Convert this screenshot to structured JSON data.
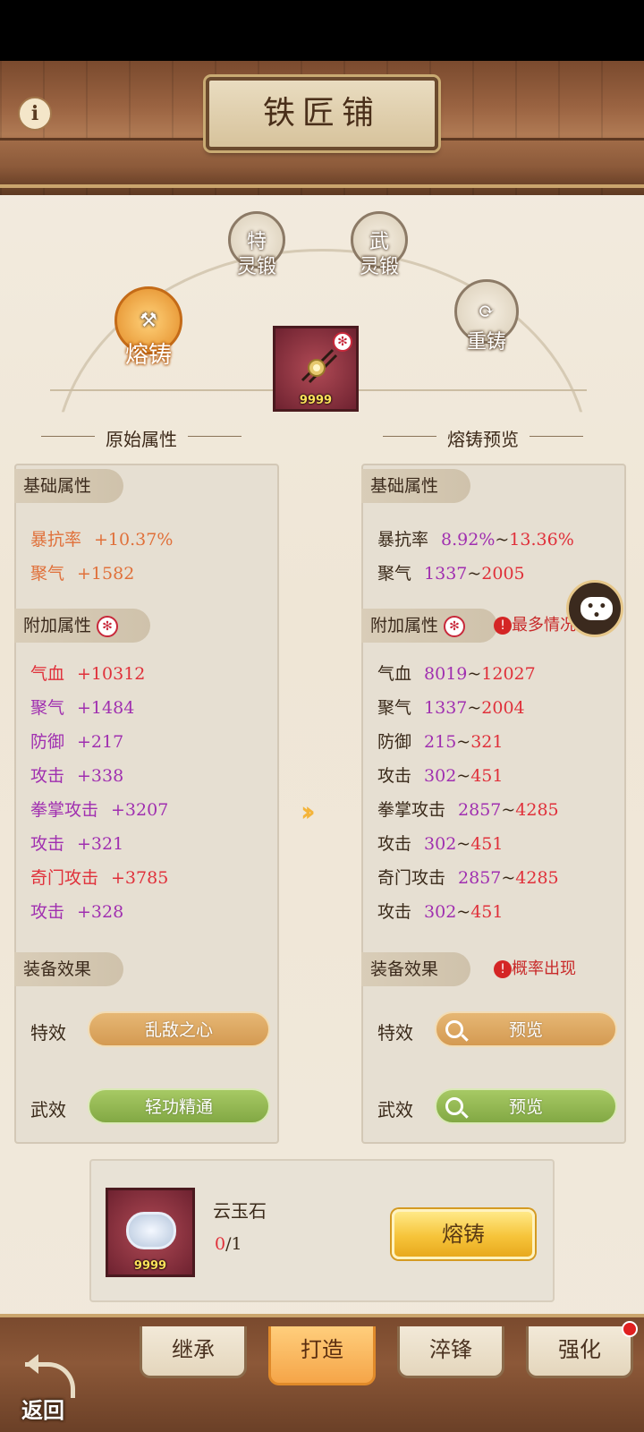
{
  "header": {
    "title": "铁匠铺",
    "info_icon": "i"
  },
  "modes": {
    "active": {
      "label": "熔铸",
      "icon": "anvil-icon"
    },
    "special": {
      "glyph": "特",
      "label": "灵锻"
    },
    "martial": {
      "glyph": "武",
      "label": "灵锻"
    },
    "recast": {
      "label": "重铸",
      "icon": "recycle-icon"
    }
  },
  "item": {
    "count": "9999",
    "icon": "hairpin-icon"
  },
  "left": {
    "title": "原始属性",
    "base_tag": "基础属性",
    "base": [
      {
        "name": "暴抗率",
        "value": "+10.37%"
      },
      {
        "name": "聚气",
        "value": "+1582"
      }
    ],
    "extra_tag": "附加属性",
    "extra": [
      {
        "name": "气血",
        "value": "+10312"
      },
      {
        "name": "聚气",
        "value": "+1484"
      },
      {
        "name": "防御",
        "value": "+217"
      },
      {
        "name": "攻击",
        "value": "+338"
      },
      {
        "name": "拳掌攻击",
        "value": "+3207"
      },
      {
        "name": "攻击",
        "value": "+321"
      },
      {
        "name": "奇门攻击",
        "value": "+3785"
      },
      {
        "name": "攻击",
        "value": "+328"
      }
    ],
    "effect_tag": "装备效果",
    "special_label": "特效",
    "special_value": "乱敌之心",
    "martial_label": "武效",
    "martial_value": "轻功精通"
  },
  "right": {
    "title": "熔铸预览",
    "base_tag": "基础属性",
    "base": [
      {
        "name": "暴抗率",
        "low": "8.92%",
        "sep": "~",
        "high": "13.36%"
      },
      {
        "name": "聚气",
        "low": "1337",
        "sep": "~",
        "high": "2005"
      }
    ],
    "extra_tag": "附加属性",
    "extra_warning": "最多情况",
    "extra": [
      {
        "name": "气血",
        "low": "8019",
        "sep": "~",
        "high": "12027"
      },
      {
        "name": "聚气",
        "low": "1337",
        "sep": "~",
        "high": "2004"
      },
      {
        "name": "防御",
        "low": "215",
        "sep": "~",
        "high": "321"
      },
      {
        "name": "攻击",
        "low": "302",
        "sep": "~",
        "high": "451"
      },
      {
        "name": "拳掌攻击",
        "low": "2857",
        "sep": "~",
        "high": "4285"
      },
      {
        "name": "攻击",
        "low": "302",
        "sep": "~",
        "high": "451"
      },
      {
        "name": "奇门攻击",
        "low": "2857",
        "sep": "~",
        "high": "4285"
      },
      {
        "name": "攻击",
        "low": "302",
        "sep": "~",
        "high": "451"
      }
    ],
    "effect_tag": "装备效果",
    "effect_warning": "概率出现",
    "special_label": "特效",
    "special_button": "预览",
    "martial_label": "武效",
    "martial_button": "预览"
  },
  "material": {
    "name": "云玉石",
    "have": "0",
    "need": "/1",
    "count": "9999",
    "forge_button": "熔铸"
  },
  "tabs": [
    {
      "label": "继承"
    },
    {
      "label": "打造"
    },
    {
      "label": "淬锋"
    },
    {
      "label": "强化"
    }
  ],
  "back_label": "返回"
}
